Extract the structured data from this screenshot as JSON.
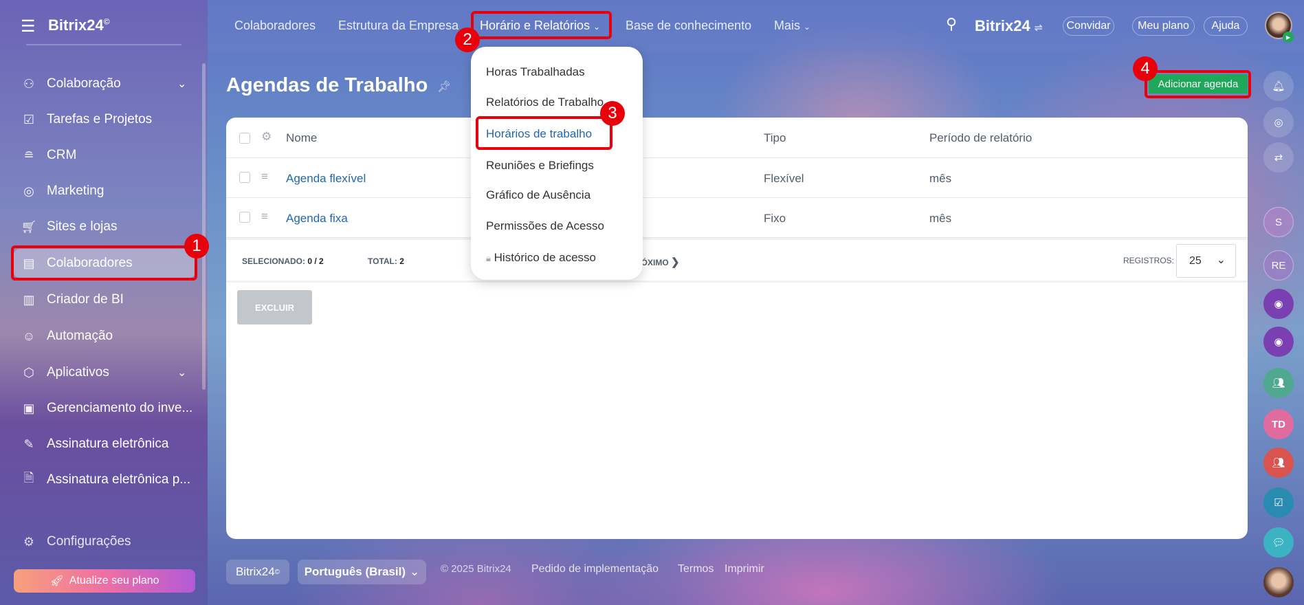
{
  "app": {
    "logo": "Bitrix24",
    "logo_mark": "©"
  },
  "topnav": {
    "items": [
      "Colaboradores",
      "Estrutura da Empresa",
      "Horário e Relatórios",
      "Base de conhecimento",
      "Mais"
    ],
    "brand": "Bitrix24",
    "invite": "Convidar",
    "plan": "Meu plano",
    "help": "Ajuda"
  },
  "sidebar": {
    "items": [
      {
        "label": "Colaboração",
        "icon": "collab-icon",
        "chevron": true
      },
      {
        "label": "Tarefas e Projetos",
        "icon": "tasks-icon"
      },
      {
        "label": "CRM",
        "icon": "crm-icon"
      },
      {
        "label": "Marketing",
        "icon": "marketing-icon"
      },
      {
        "label": "Sites e lojas",
        "icon": "cart-icon"
      },
      {
        "label": "Colaboradores",
        "icon": "employees-icon"
      },
      {
        "label": "Criador de BI",
        "icon": "bi-icon"
      },
      {
        "label": "Automação",
        "icon": "robot-icon"
      },
      {
        "label": "Aplicativos",
        "icon": "box-icon",
        "chevron": true
      },
      {
        "label": "Gerenciamento do inve...",
        "icon": "inventory-icon"
      },
      {
        "label": "Assinatura eletrônica",
        "icon": "pen-icon"
      },
      {
        "label": "Assinatura eletrônica p...",
        "icon": "doc-sign-icon"
      }
    ],
    "settings": "Configurações",
    "upgrade": "Atualize seu plano"
  },
  "page": {
    "title": "Agendas de Trabalho",
    "add_button": "Adicionar agenda"
  },
  "table": {
    "columns": [
      "Nome",
      "Tipo",
      "Período de relatório"
    ],
    "rows": [
      {
        "name": "Agenda flexível",
        "type": "Flexível",
        "period": "mês"
      },
      {
        "name": "Agenda fixa",
        "type": "Fixo",
        "period": "mês"
      }
    ],
    "selected_label": "SELECIONADO:",
    "selected_value": "0 / 2",
    "total_label": "TOTAL:",
    "total_value": "2",
    "next": "PRÓXIMO",
    "records_label": "REGISTROS:",
    "records_value": "25",
    "delete": "EXCLUIR"
  },
  "menu": {
    "items": [
      "Horas Trabalhadas",
      "Relatórios de Trabalho",
      "Horários de trabalho",
      "Reuniões e Briefings",
      "Gráfico de Ausência",
      "Permissões de Acesso",
      "Histórico de acesso"
    ]
  },
  "annotations": [
    "1",
    "2",
    "3",
    "4"
  ],
  "rail": {
    "s": "S",
    "re": "RE",
    "td": "TD"
  },
  "footer": {
    "brand": "Bitrix24",
    "language": "Português (Brasil)",
    "copyright": "© 2025 Bitrix24",
    "impl": "Pedido de implementação",
    "terms": "Termos",
    "print": "Imprimir"
  },
  "colors": {
    "accent": "#2067b0",
    "green": "#1fa85a",
    "annotation": "#e8000b"
  }
}
